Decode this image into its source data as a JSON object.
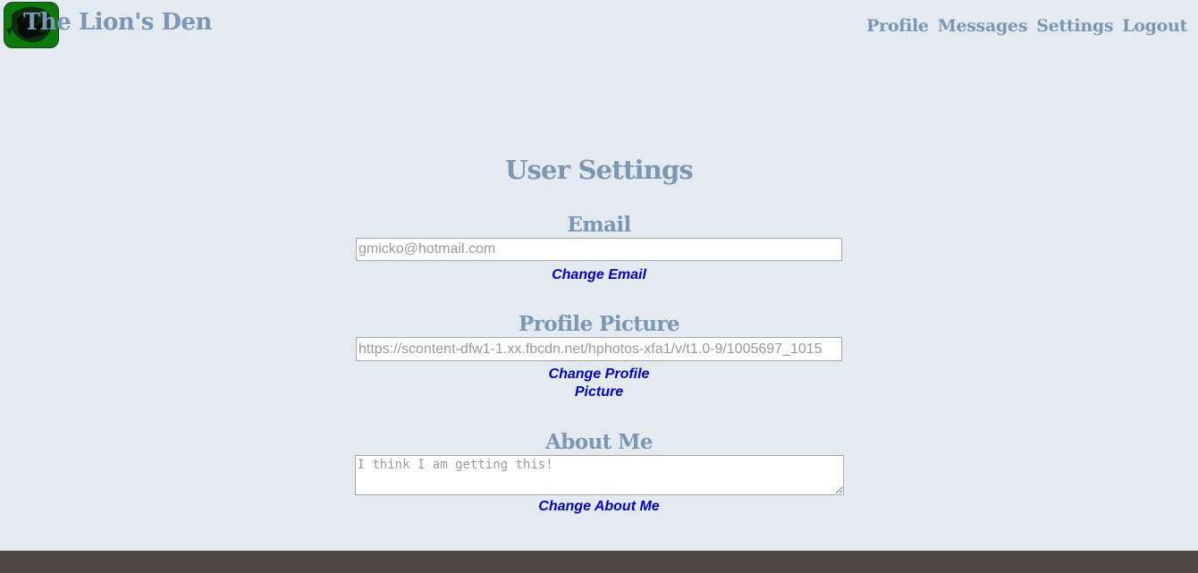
{
  "header": {
    "site_title": "The Lion's Den",
    "nav": [
      {
        "label": "Profile"
      },
      {
        "label": "Messages"
      },
      {
        "label": "Settings"
      },
      {
        "label": "Logout"
      }
    ]
  },
  "main": {
    "title": "User Settings",
    "email": {
      "heading": "Email",
      "placeholder": "gmicko@hotmail.com",
      "action_label": "Change Email"
    },
    "profile_picture": {
      "heading": "Profile Picture",
      "placeholder": "https://scontent-dfw1-1.xx.fbcdn.net/hphotos-xfa1/v/t1.0-9/1005697_1015",
      "action_line1": "Change Profile",
      "action_line2": "Picture"
    },
    "about_me": {
      "heading": "About Me",
      "placeholder": "I think I am getting this!",
      "action_label": "Change About Me"
    }
  },
  "colors": {
    "background": "#e3eaf0",
    "heading": "#7a97b3",
    "link": "#0000cc",
    "footer": "#4e4845",
    "logo_green": "#0a7a0a"
  }
}
